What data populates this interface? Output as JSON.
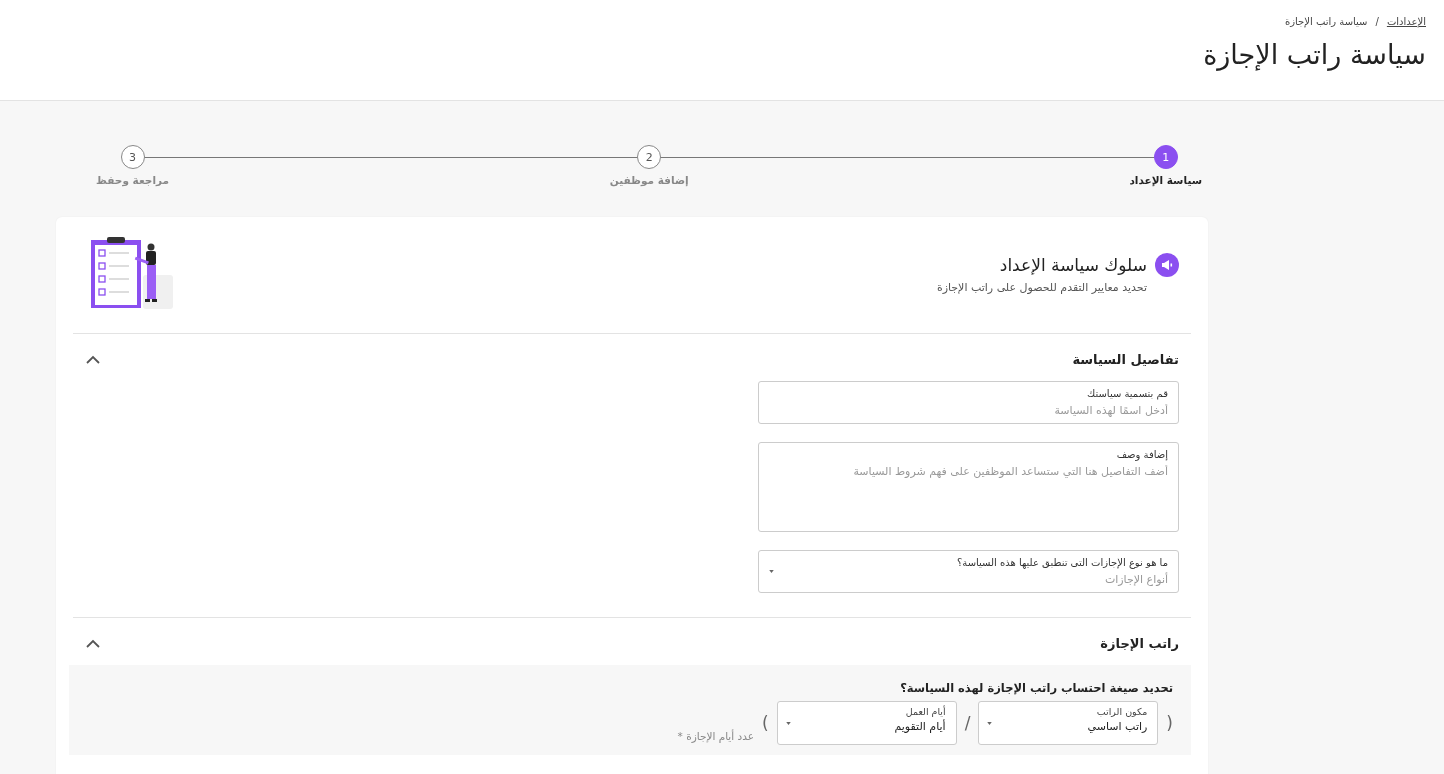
{
  "breadcrumb": [
    {
      "label": "الإعدادات",
      "link": true
    },
    {
      "label": "سياسة راتب الإجازة",
      "link": false
    }
  ],
  "breadcrumb_separator": "/",
  "title": "سياسة راتب الإجازة",
  "steps": [
    {
      "number": "1",
      "label": "سياسة الإعداد",
      "selected": true
    },
    {
      "number": "2",
      "label": "إضافة موظفين",
      "selected": false
    },
    {
      "number": "3",
      "label": "مراجعة وحفظ",
      "selected": false
    }
  ],
  "intro": {
    "title": "سلوك سياسة الإعداد",
    "subtitle": "تحديد معايير التقدم للحصول على راتب الإجازة"
  },
  "sections": [
    {
      "title": "تفاصيل السياسة",
      "expanded": true,
      "fields": [
        {
          "kind": "text",
          "label": "قم بتسمية سياستك",
          "placeholder": "أدخل اسمًا لهذه السياسة"
        },
        {
          "kind": "textarea",
          "label": "إضافة وصف",
          "placeholder": "أضف التفاصيل هنا التي ستساعد الموظفين على فهم شروط السياسة"
        },
        {
          "kind": "select",
          "label": "ما هو نوع الإجازات التى تنطبق عليها هذه السياسة؟",
          "placeholder": "أنواع الإجازات"
        }
      ]
    },
    {
      "title": "راتب الإجازة",
      "expanded": true,
      "formula": {
        "question": "تحديد صيغة احتساب راتب الإجازة لهذه السياسة؟",
        "open": "(",
        "selects": [
          {
            "label": "مكون الراتب",
            "value": "راتب اساسي"
          },
          {
            "label": "أيام العمل",
            "value": "أيام التقويم"
          }
        ],
        "separator": "/",
        "close": ")",
        "result": "عدد أيام الإجازة *"
      }
    }
  ]
}
